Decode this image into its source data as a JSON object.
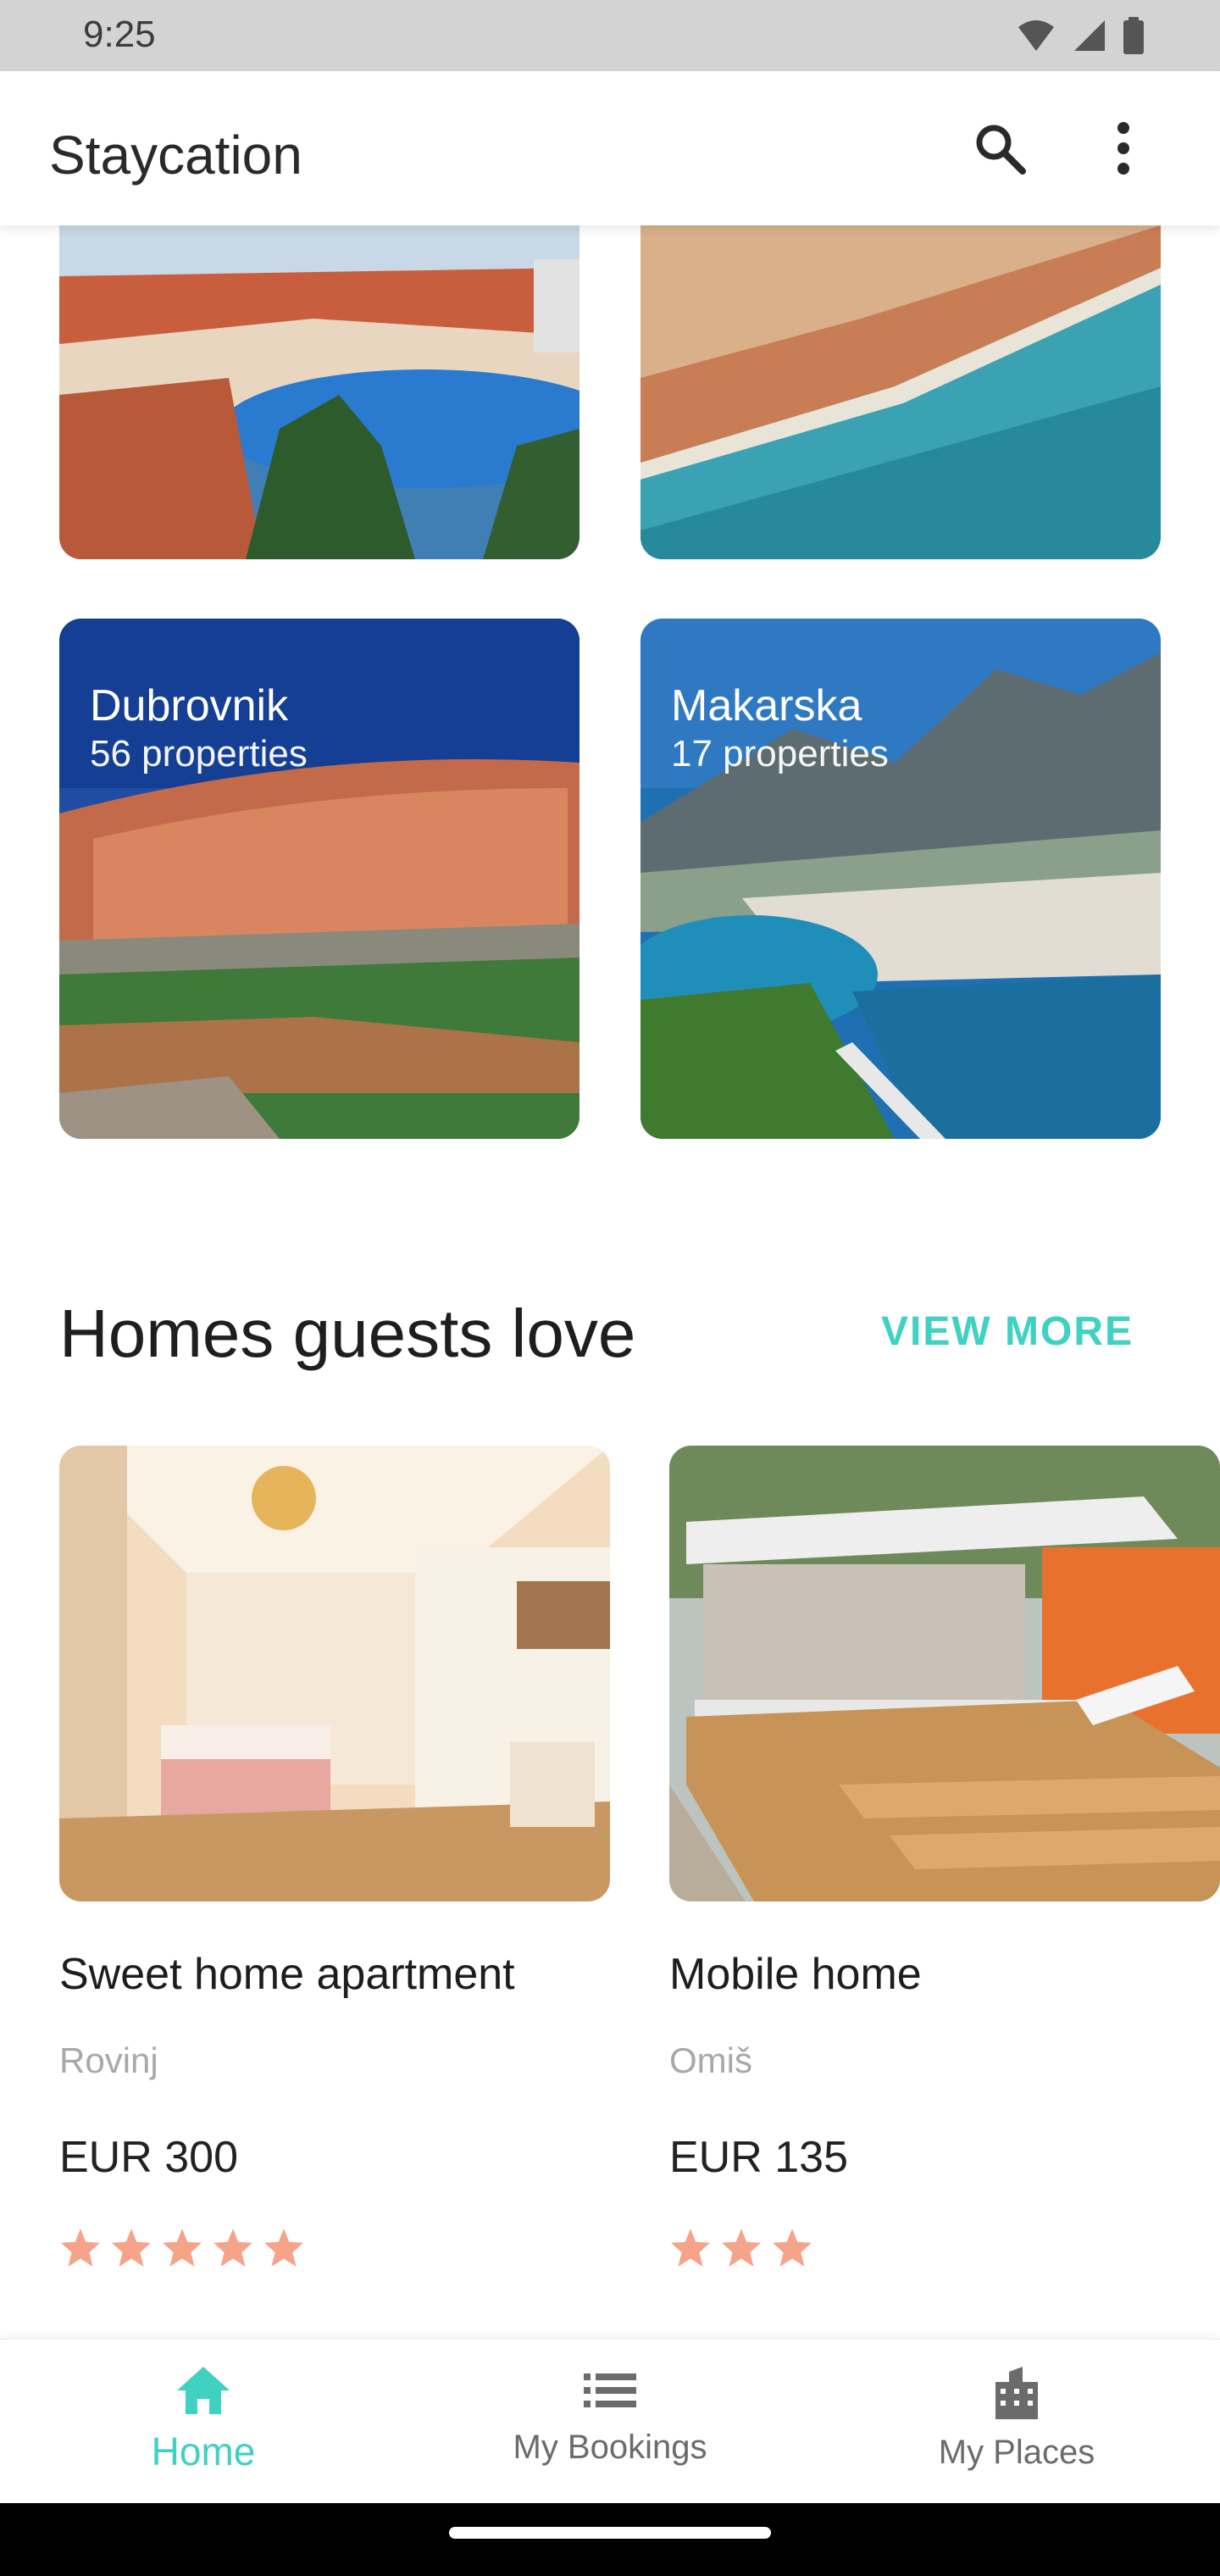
{
  "status_bar": {
    "time": "9:25"
  },
  "app_bar": {
    "title": "Staycation",
    "search_icon": "search-icon",
    "more_icon": "more-vert-icon"
  },
  "destinations": [
    {
      "name": "Dubrovnik",
      "count": "56 properties"
    },
    {
      "name": "Makarska",
      "count": "17 properties"
    }
  ],
  "homes_section": {
    "title": "Homes guests love",
    "view_more": "VIEW MORE"
  },
  "homes": [
    {
      "title": "Sweet home apartment",
      "city": "Rovinj",
      "price": "EUR 300",
      "rating": 5
    },
    {
      "title": "Mobile home",
      "city": "Omiš",
      "price": "EUR 135",
      "rating": 3
    }
  ],
  "bottom_nav": {
    "items": [
      {
        "label": "Home",
        "icon": "home-icon",
        "active": true
      },
      {
        "label": "My Bookings",
        "icon": "list-icon",
        "active": false
      },
      {
        "label": "My Places",
        "icon": "building-icon",
        "active": false
      }
    ]
  },
  "colors": {
    "accent": "#3fd1c1",
    "star": "#f5a48a",
    "inactive": "#6b6b6b"
  }
}
